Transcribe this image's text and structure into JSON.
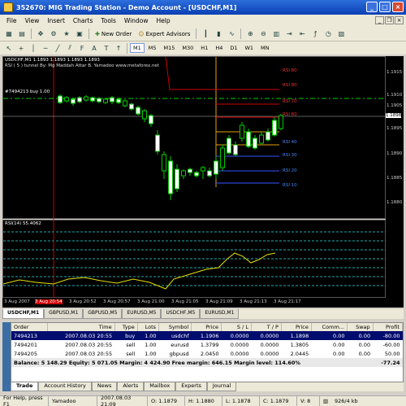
{
  "window": {
    "title": "352670: MIG Trading Station - Demo Account - [USDCHF,M1]"
  },
  "menu": [
    "File",
    "View",
    "Insert",
    "Charts",
    "Tools",
    "Window",
    "Help"
  ],
  "toolbar": {
    "new_order": "New Order",
    "expert_advisors": "Expert Advisors"
  },
  "timeframes": [
    "M1",
    "M5",
    "M15",
    "M30",
    "H1",
    "H4",
    "D1",
    "W1",
    "MN"
  ],
  "chart": {
    "header": "USDCHF,M1  1.1893 1.1893 1.1893 1.1893",
    "indicator_label": "RSI ( 5 ) tunnel By: Mg Maddah Attar B. Yamadoo  www.metaforex.net",
    "order_line": "#7494213 buy 1.00",
    "rsi_levels": [
      "RSI 80",
      "RSI 70",
      "RSI 60",
      "RSI 50",
      "RSI 40",
      "RSI 30",
      "RSI 20",
      "RSI 10"
    ],
    "price_labels": [
      "1.1915",
      "1.1910",
      "1.1905",
      "1.1898",
      "1.1895",
      "1.1890",
      "1.1885",
      "1.1880"
    ],
    "current_price": "1.1898"
  },
  "indicator": {
    "label": "RSI(14) 55.4062"
  },
  "time_axis": [
    "3 Aug 2007",
    "3 Aug 20:52",
    "3 Aug 20:57",
    "3 Aug 21:00",
    "3 Aug 21:01",
    "3 Aug 21:05",
    "3 Aug 21:09",
    "3 Aug 21:13",
    "3 Aug 21:17"
  ],
  "time_axis_highlight": "3 Aug 20:54",
  "chart_tabs": [
    "USDCHF,M1",
    "GBPUSD,M1",
    "GBPUSD,M5",
    "EURUSD,M5",
    "USDCHF,M5",
    "EURUSD,M1"
  ],
  "terminal": {
    "columns": [
      "Order",
      "Time",
      "Type",
      "Lots",
      "Symbol",
      "Price",
      "S / L",
      "T / P",
      "Price",
      "Comm...",
      "Swap",
      "Profit"
    ],
    "rows": [
      [
        "7494213",
        "2007.08.03 20:55",
        "buy",
        "1.00",
        "usdchf",
        "1.1906",
        "0.0000",
        "0.0000",
        "1.1898",
        "0.00",
        "0.00",
        "-80.00"
      ],
      [
        "7494201",
        "2007.08.03 20:55",
        "sell",
        "1.00",
        "eurusd",
        "1.3799",
        "0.0000",
        "0.0000",
        "1.3805",
        "0.00",
        "0.00",
        "-60.00"
      ],
      [
        "7494205",
        "2007.08.03 20:55",
        "sell",
        "1.00",
        "gbpusd",
        "2.0450",
        "0.0000",
        "0.0000",
        "2.0445",
        "0.00",
        "0.00",
        "50.00"
      ]
    ],
    "balance": "Balance: 5 148.29  Equity: 5 071.05  Margin: 4 424.90  Free margin: 646.15  Margin level: 114.60%",
    "balance_profit": "-77.24",
    "tabs": [
      "Trade",
      "Account History",
      "News",
      "Alerts",
      "Mailbox",
      "Experts",
      "Journal"
    ]
  },
  "status": {
    "help": "For Help, press F1",
    "profile": "Yamadoo",
    "datetime": "2007.08.03 21:09",
    "open": "O: 1.1879",
    "high": "H: 1.1880",
    "low": "L: 1.1878",
    "close": "C: 1.1879",
    "volume": "V: 8",
    "net": "926/4 kb"
  }
}
